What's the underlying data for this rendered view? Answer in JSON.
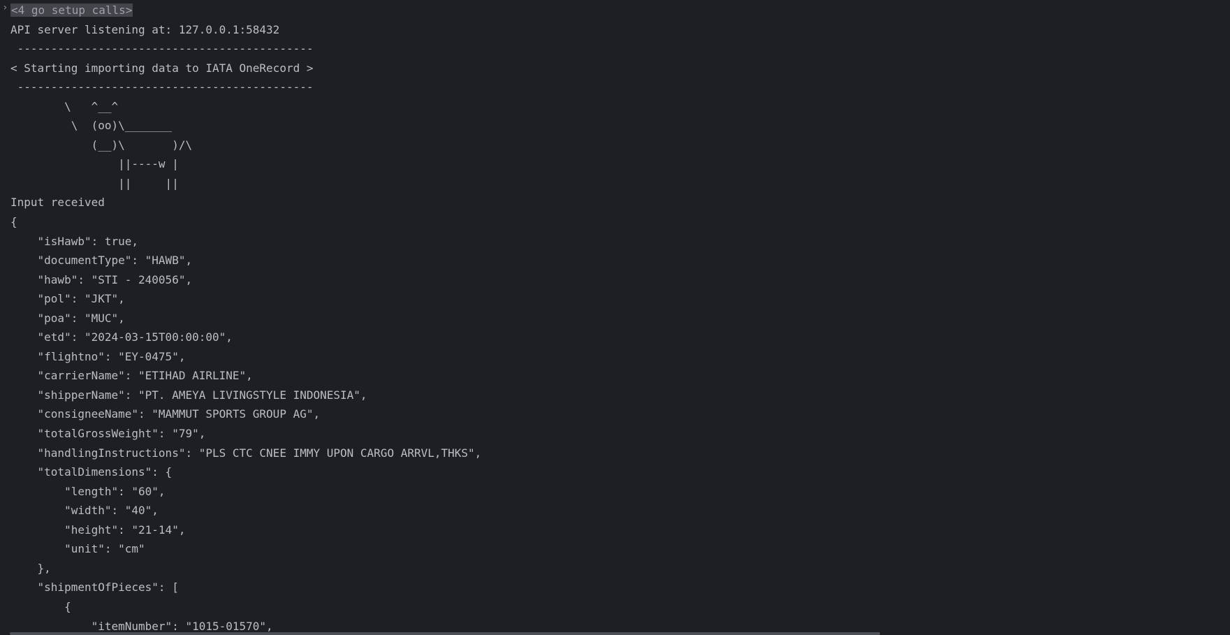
{
  "console": {
    "gutter_icon": "chevron-right-icon",
    "folded_label": "<4 go setup calls>",
    "lines": [
      "API server listening at: 127.0.0.1:58432",
      " --------------------------------------------",
      "< Starting importing data to IATA OneRecord >",
      " --------------------------------------------",
      "        \\   ^__^",
      "         \\  (oo)\\_______",
      "            (__)\\       )/\\",
      "                ||----w |",
      "                ||     ||",
      "Input received",
      "{",
      "    \"isHawb\": true,",
      "    \"documentType\": \"HAWB\",",
      "    \"hawb\": \"STI - 240056\",",
      "    \"pol\": \"JKT\",",
      "    \"poa\": \"MUC\",",
      "    \"etd\": \"2024-03-15T00:00:00\",",
      "    \"flightno\": \"EY-0475\",",
      "    \"carrierName\": \"ETIHAD AIRLINE\",",
      "    \"shipperName\": \"PT. AMEYA LIVINGSTYLE INDONESIA\",",
      "    \"consigneeName\": \"MAMMUT SPORTS GROUP AG\",",
      "    \"totalGrossWeight\": \"79\",",
      "    \"handlingInstructions\": \"PLS CTC CNEE IMMY UPON CARGO ARRVL,THKS\",",
      "    \"totalDimensions\": {",
      "        \"length\": \"60\",",
      "        \"width\": \"40\",",
      "        \"height\": \"21-14\",",
      "        \"unit\": \"cm\"",
      "    },",
      "    \"shipmentOfPieces\": [",
      "        {",
      "            \"itemNumber\": \"1015-01570\","
    ]
  },
  "colors": {
    "background": "#1e1f22",
    "text": "#bcbec4",
    "folded_bg": "#43454a",
    "scrollbar": "#4e5157"
  }
}
